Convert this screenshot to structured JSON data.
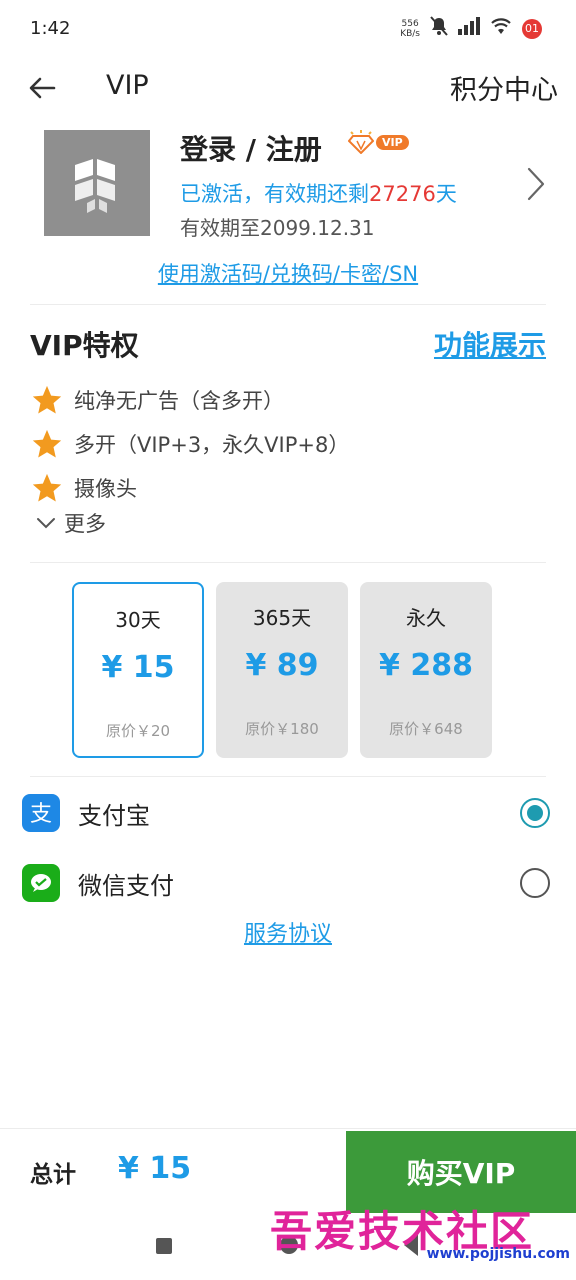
{
  "status_bar": {
    "time": "1:42",
    "speed_value": "556",
    "speed_unit": "KB/s",
    "notification_count": "01"
  },
  "header": {
    "title": "VIP",
    "points_center": "积分中心"
  },
  "profile": {
    "name": "登录 / 注册",
    "badge": "VIP",
    "status_prefix": "已激活，有效期还剩",
    "days_left": "27276",
    "status_suffix": "天",
    "expire": "有效期至2099.12.31"
  },
  "redeem_link": "使用激活码/兑换码/卡密/SN",
  "privileges": {
    "title": "VIP特权",
    "show_link": "功能展示",
    "items": [
      {
        "text": "纯净无广告（含多开）",
        "icon": "star-icon"
      },
      {
        "text": "多开（VIP+3，永久VIP+8）",
        "icon": "star-icon"
      },
      {
        "text": "摄像头",
        "icon": "star-icon"
      }
    ],
    "more": "更多"
  },
  "plans": [
    {
      "duration": "30天",
      "price": "¥ 15",
      "original": "原价￥20",
      "selected": true
    },
    {
      "duration": "365天",
      "price": "¥ 89",
      "original": "原价￥180",
      "selected": false
    },
    {
      "duration": "永久",
      "price": "¥ 288",
      "original": "原价￥648",
      "selected": false
    }
  ],
  "payment": {
    "options": [
      {
        "label": "支付宝",
        "icon": "alipay-icon",
        "selected": true
      },
      {
        "label": "微信支付",
        "icon": "wechat-pay-icon",
        "selected": false
      }
    ]
  },
  "agreement": "服务协议",
  "footer": {
    "total_label": "总计",
    "total_value": "¥ 15",
    "buy_button": "购买VIP"
  },
  "watermark": {
    "text": "吾爱技术社区",
    "url": "www.pojjishu.com"
  },
  "colors": {
    "accent": "#1e9be6",
    "buy_button": "#3c9a3a",
    "days_highlight": "#e53935",
    "star": "#f29a1f"
  }
}
